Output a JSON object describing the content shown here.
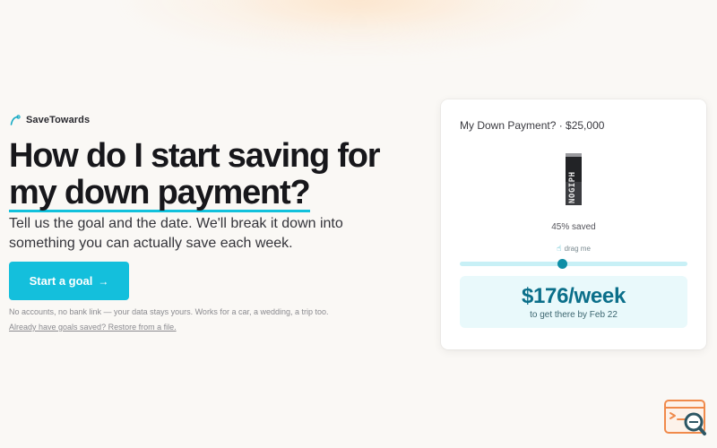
{
  "brand": {
    "name": "SaveTowards",
    "icon": "trend-curve-icon",
    "accent": "#14bfdc"
  },
  "hero": {
    "headline_line1": "How do I start saving for",
    "headline_line2": "my down payment?",
    "subtitle": "Tell us the goal and the date. We'll break it down into something you can actually save each week.",
    "cta_label": "Start a goal",
    "cta_icon": "arrow-right-icon",
    "fine_print": "No accounts, no bank link — your data stays yours. Works for a car, a wedding, a trip too.",
    "restore_link": "Already have goals saved? Restore from a file."
  },
  "goal_card": {
    "title": "My Down Payment? · $25,000",
    "jar_label": "NOGIPH",
    "saved_fraction": 0.45,
    "saved_label": "45% saved",
    "drag_hint": "drag me",
    "drag_icon": "hand-drag-icon",
    "weekly_amount": "$176/week",
    "target_text": "to get there by Feb 22"
  },
  "corner_badge": {
    "icon": "search-code-icon"
  }
}
